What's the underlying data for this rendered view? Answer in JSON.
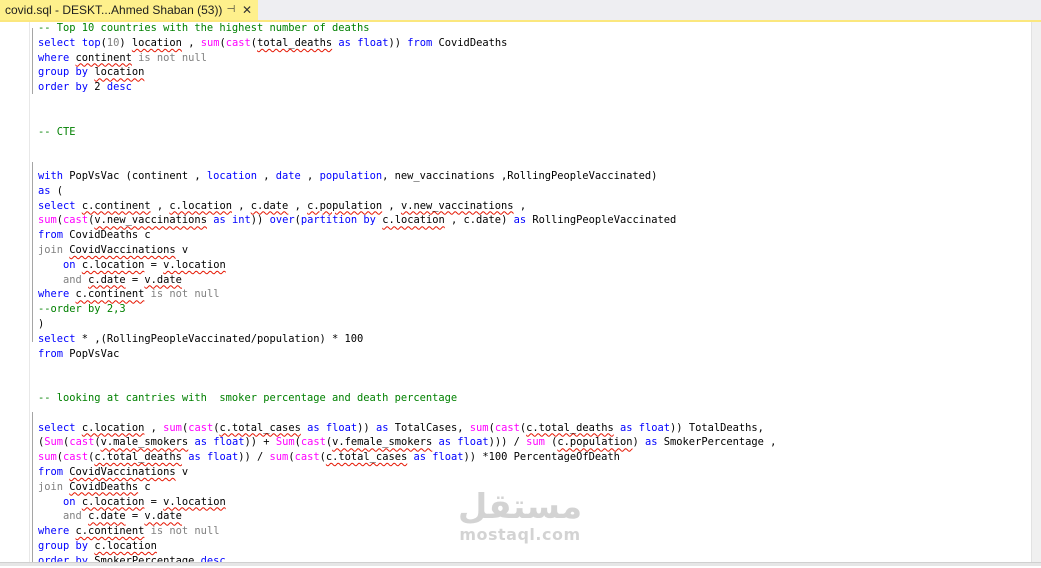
{
  "tab": {
    "title": "covid.sql - DESKT...Ahmed Shaban (53))",
    "pin_glyph": "⊣",
    "close_glyph": "✕"
  },
  "code_lines": [
    [
      [
        "-- Top 10 countries with the highest number of deaths",
        "cm"
      ]
    ],
    [
      [
        "select",
        "kw"
      ],
      [
        " ",
        ""
      ],
      [
        "top",
        "kw"
      ],
      [
        "(",
        ""
      ],
      [
        "10",
        "gr"
      ],
      [
        ") ",
        ""
      ],
      [
        "location",
        "sq"
      ],
      [
        " , ",
        ""
      ],
      [
        "sum",
        "fn"
      ],
      [
        "(",
        ""
      ],
      [
        "cast",
        "fn"
      ],
      [
        "(",
        ""
      ],
      [
        "total_deaths",
        "sq"
      ],
      [
        " ",
        ""
      ],
      [
        "as",
        "kw"
      ],
      [
        " ",
        ""
      ],
      [
        "float",
        "kw"
      ],
      [
        ")) ",
        ""
      ],
      [
        "from",
        "kw"
      ],
      [
        " CovidDeaths",
        ""
      ]
    ],
    [
      [
        "where",
        "kw"
      ],
      [
        " ",
        ""
      ],
      [
        "continent",
        "sq"
      ],
      [
        " ",
        ""
      ],
      [
        "is not null",
        "gr"
      ]
    ],
    [
      [
        "group by",
        "kw"
      ],
      [
        " ",
        ""
      ],
      [
        "location",
        "sq"
      ]
    ],
    [
      [
        "order by",
        "kw"
      ],
      [
        " 2 ",
        ""
      ],
      [
        "desc",
        "kw"
      ]
    ],
    [],
    [],
    [
      [
        "-- CTE",
        "cm"
      ]
    ],
    [],
    [],
    [
      [
        "with",
        "kw"
      ],
      [
        " PopVsVac (continent , ",
        ""
      ],
      [
        "location",
        "kw"
      ],
      [
        " , ",
        ""
      ],
      [
        "date",
        "kw"
      ],
      [
        " , ",
        ""
      ],
      [
        "population",
        "kw"
      ],
      [
        ", new_vaccinations ,RollingPeopleVaccinated)",
        ""
      ]
    ],
    [
      [
        "as",
        "kw"
      ],
      [
        " (",
        ""
      ]
    ],
    [
      [
        "select",
        "kw"
      ],
      [
        " ",
        ""
      ],
      [
        "c.continent",
        "sq"
      ],
      [
        " , ",
        ""
      ],
      [
        "c.location",
        "sq"
      ],
      [
        " , ",
        ""
      ],
      [
        "c.date",
        "sq"
      ],
      [
        " , ",
        ""
      ],
      [
        "c.population",
        "sq"
      ],
      [
        " , ",
        ""
      ],
      [
        "v.new_vaccinations",
        "sq"
      ],
      [
        " ,",
        ""
      ]
    ],
    [
      [
        "sum",
        "fn"
      ],
      [
        "(",
        ""
      ],
      [
        "cast",
        "fn"
      ],
      [
        "(",
        ""
      ],
      [
        "v.new_vaccinations",
        "sq"
      ],
      [
        " ",
        ""
      ],
      [
        "as",
        "kw"
      ],
      [
        " ",
        ""
      ],
      [
        "int",
        "kw"
      ],
      [
        ")) ",
        ""
      ],
      [
        "over",
        "kw"
      ],
      [
        "(",
        ""
      ],
      [
        "partition by",
        "kw"
      ],
      [
        " ",
        ""
      ],
      [
        "c.location",
        "sq"
      ],
      [
        " , c.date) ",
        ""
      ],
      [
        "as",
        "kw"
      ],
      [
        " RollingPeopleVaccinated",
        ""
      ]
    ],
    [
      [
        "from",
        "kw"
      ],
      [
        " CovidDeaths c",
        ""
      ]
    ],
    [
      [
        "join",
        "gr"
      ],
      [
        " ",
        ""
      ],
      [
        "CovidVaccinations",
        "sq"
      ],
      [
        " v",
        ""
      ]
    ],
    [
      [
        "    ",
        ""
      ],
      [
        "on",
        "kw"
      ],
      [
        " ",
        ""
      ],
      [
        "c.location",
        "sq"
      ],
      [
        " = ",
        ""
      ],
      [
        "v.location",
        "sq"
      ]
    ],
    [
      [
        "    ",
        ""
      ],
      [
        "and",
        "gr"
      ],
      [
        " ",
        ""
      ],
      [
        "c.date",
        "sq"
      ],
      [
        " = ",
        ""
      ],
      [
        "v.date",
        "sq"
      ]
    ],
    [
      [
        "where",
        "kw"
      ],
      [
        " ",
        ""
      ],
      [
        "c.continent",
        "sq"
      ],
      [
        " ",
        ""
      ],
      [
        "is not null",
        "gr"
      ]
    ],
    [
      [
        "--order by 2,3",
        "cm"
      ]
    ],
    [
      [
        ")",
        ""
      ]
    ],
    [
      [
        "select",
        "kw"
      ],
      [
        " * ,(RollingPeopleVaccinated/population) * 100",
        ""
      ]
    ],
    [
      [
        "from",
        "kw"
      ],
      [
        " PopVsVac",
        ""
      ]
    ],
    [],
    [],
    [
      [
        "-- looking at cantries with  smoker percentage and death percentage",
        "cm"
      ]
    ],
    [],
    [
      [
        "select",
        "kw"
      ],
      [
        " ",
        ""
      ],
      [
        "c.location",
        "sq"
      ],
      [
        " , ",
        ""
      ],
      [
        "sum",
        "fn"
      ],
      [
        "(",
        ""
      ],
      [
        "cast",
        "fn"
      ],
      [
        "(",
        ""
      ],
      [
        "c.total_cases",
        "sq"
      ],
      [
        " ",
        ""
      ],
      [
        "as",
        "kw"
      ],
      [
        " ",
        ""
      ],
      [
        "float",
        "kw"
      ],
      [
        ")) ",
        ""
      ],
      [
        "as",
        "kw"
      ],
      [
        " TotalCases, ",
        ""
      ],
      [
        "sum",
        "fn"
      ],
      [
        "(",
        ""
      ],
      [
        "cast",
        "fn"
      ],
      [
        "(",
        ""
      ],
      [
        "c.total_deaths",
        "sq"
      ],
      [
        " ",
        ""
      ],
      [
        "as",
        "kw"
      ],
      [
        " ",
        ""
      ],
      [
        "float",
        "kw"
      ],
      [
        ")) TotalDeaths,",
        ""
      ]
    ],
    [
      [
        "(",
        ""
      ],
      [
        "Sum",
        "fn"
      ],
      [
        "(",
        ""
      ],
      [
        "cast",
        "fn"
      ],
      [
        "(",
        ""
      ],
      [
        "v.male_smokers",
        "sq"
      ],
      [
        " ",
        ""
      ],
      [
        "as",
        "kw"
      ],
      [
        " ",
        ""
      ],
      [
        "float",
        "kw"
      ],
      [
        ")) + ",
        ""
      ],
      [
        "Sum",
        "fn"
      ],
      [
        "(",
        ""
      ],
      [
        "cast",
        "fn"
      ],
      [
        "(",
        ""
      ],
      [
        "v.female_smokers",
        "sq"
      ],
      [
        " ",
        ""
      ],
      [
        "as",
        "kw"
      ],
      [
        " ",
        ""
      ],
      [
        "float",
        "kw"
      ],
      [
        "))) / ",
        ""
      ],
      [
        "sum",
        "fn"
      ],
      [
        " (",
        ""
      ],
      [
        "c.population",
        "sq"
      ],
      [
        ") ",
        ""
      ],
      [
        "as",
        "kw"
      ],
      [
        " SmokerPercentage ,",
        ""
      ]
    ],
    [
      [
        "sum",
        "fn"
      ],
      [
        "(",
        ""
      ],
      [
        "cast",
        "fn"
      ],
      [
        "(",
        ""
      ],
      [
        "c.total_deaths",
        "sq"
      ],
      [
        " ",
        ""
      ],
      [
        "as",
        "kw"
      ],
      [
        " ",
        ""
      ],
      [
        "float",
        "kw"
      ],
      [
        ")) / ",
        ""
      ],
      [
        "sum",
        "fn"
      ],
      [
        "(",
        ""
      ],
      [
        "cast",
        "fn"
      ],
      [
        "(",
        ""
      ],
      [
        "c.total_cases",
        "sq"
      ],
      [
        " ",
        ""
      ],
      [
        "as",
        "kw"
      ],
      [
        " ",
        ""
      ],
      [
        "float",
        "kw"
      ],
      [
        ")) *100 PercentageOfDeath",
        ""
      ]
    ],
    [
      [
        "from",
        "kw"
      ],
      [
        " ",
        ""
      ],
      [
        "CovidVaccinations",
        "sq"
      ],
      [
        " v",
        ""
      ]
    ],
    [
      [
        "join",
        "gr"
      ],
      [
        " ",
        ""
      ],
      [
        "CovidDeaths",
        "sq"
      ],
      [
        " c",
        ""
      ]
    ],
    [
      [
        "    ",
        ""
      ],
      [
        "on",
        "kw"
      ],
      [
        " ",
        ""
      ],
      [
        "c.location",
        "sq"
      ],
      [
        " = ",
        ""
      ],
      [
        "v.location",
        "sq"
      ]
    ],
    [
      [
        "    ",
        ""
      ],
      [
        "and",
        "gr"
      ],
      [
        " ",
        ""
      ],
      [
        "c.date",
        "sq"
      ],
      [
        " = ",
        ""
      ],
      [
        "v.date",
        "sq"
      ]
    ],
    [
      [
        "where",
        "kw"
      ],
      [
        " ",
        ""
      ],
      [
        "c.continent",
        "sq"
      ],
      [
        " ",
        ""
      ],
      [
        "is not null",
        "gr"
      ]
    ],
    [
      [
        "group by",
        "kw"
      ],
      [
        " ",
        ""
      ],
      [
        "c.location",
        "sq"
      ]
    ],
    [
      [
        "order by",
        "kw"
      ],
      [
        " SmokerPercentage ",
        ""
      ],
      [
        "desc",
        "kw"
      ]
    ]
  ],
  "watermark": {
    "arabic": "مستقل",
    "latin": "mostaql.com"
  }
}
